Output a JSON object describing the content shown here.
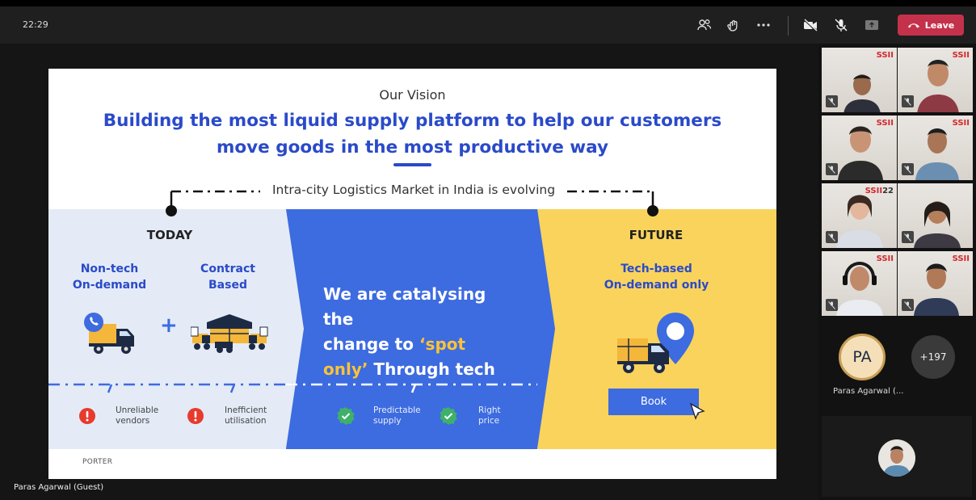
{
  "topbar": {
    "time": "22:29",
    "leave_label": "Leave",
    "icons": [
      "people-icon",
      "reactions-icon",
      "more-icon",
      "camera-off-icon",
      "mic-off-icon",
      "share-icon",
      "phone-icon"
    ]
  },
  "slide": {
    "vision": "Our Vision",
    "headline_line1": "Building the most liquid supply platform to help our customers",
    "headline_line2": "move goods in the most productive way",
    "evolving": "Intra-city Logistics Market in India is evolving",
    "today": {
      "heading": "TODAY",
      "left_label_1": "Non-tech",
      "left_label_2": "On-demand",
      "right_label_1": "Contract",
      "right_label_2": "Based",
      "issue1_1": "Unreliable",
      "issue1_2": "vendors",
      "issue2_1": "Inefficient",
      "issue2_2": "utilisation"
    },
    "middle": {
      "line1": "We are catalysing the",
      "line2_a": "change to ",
      "line2_b": "‘spot",
      "line3_a": "only’",
      "line3_b": " Through tech",
      "benefit1_1": "Predictable",
      "benefit1_2": "supply",
      "benefit2_1": "Right",
      "benefit2_2": "price"
    },
    "future": {
      "heading": "FUTURE",
      "label_1": "Tech-based",
      "label_2": "On-demand only",
      "book": "Book"
    },
    "footer_brand": "PORTER",
    "colors": {
      "brand_blue": "#2a4ac9",
      "panel_blue": "#3d6be0",
      "panel_yellow": "#f9d35c",
      "panel_grey": "#e4ebf6",
      "spot_orange": "#f8c33a"
    }
  },
  "participants": {
    "tile_brand": "SSII",
    "tile_brand_extra": "22",
    "featured_initials": "PA",
    "featured_name": "Paras Agarwal (...",
    "more_count": "+197"
  },
  "presenter_name": "Paras Agarwal (Guest)"
}
